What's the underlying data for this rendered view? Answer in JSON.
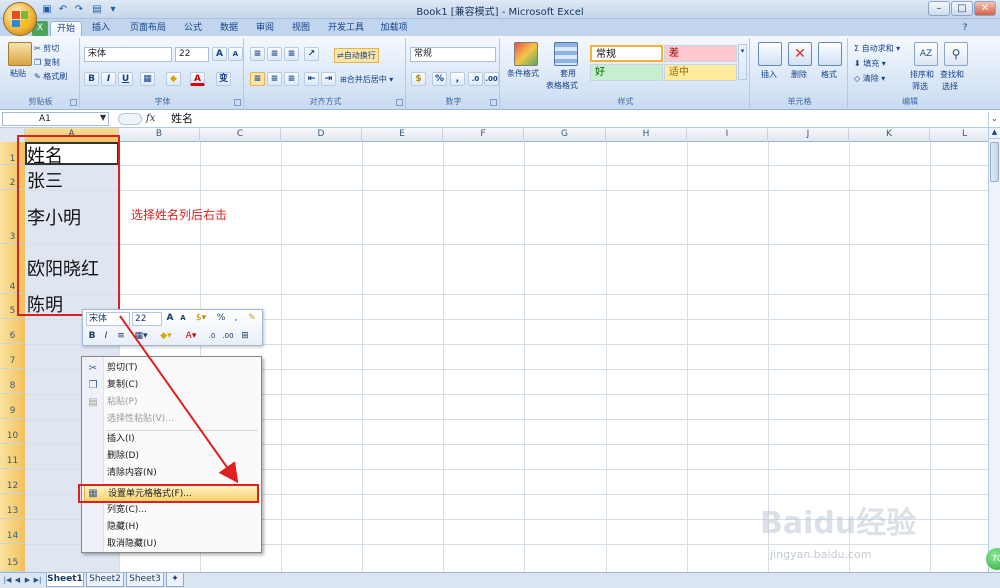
{
  "window": {
    "title": "Book1  [兼容模式] - Microsoft Excel",
    "buttons": [
      "–",
      "□",
      "✕"
    ]
  },
  "ribbon_tabs": [
    "开始",
    "插入",
    "页面布局",
    "公式",
    "数据",
    "审阅",
    "视图",
    "开发工具",
    "加载项"
  ],
  "groups": {
    "clipboard": {
      "label": "剪贴板",
      "paste": "粘贴",
      "cut": "剪切",
      "copy": "复制",
      "format_painter": "格式刷"
    },
    "font": {
      "label": "字体",
      "name": "宋体",
      "size": "22",
      "bold": "B",
      "italic": "I",
      "underline": "U",
      "grow": "A",
      "shrink": "A",
      "phonetic": "变"
    },
    "alignment": {
      "label": "对齐方式",
      "wrap": "自动换行",
      "merge": "合并后居中"
    },
    "number": {
      "label": "数字",
      "format": "常规",
      "percent": "%",
      "comma": ","
    },
    "styles": {
      "label": "样式",
      "cond": "条件格式",
      "table1": "套用",
      "table2": "表格格式",
      "normal": "常规",
      "bad": "差",
      "good": "好",
      "neutral": "适中"
    },
    "cells": {
      "label": "单元格",
      "insert": "插入",
      "delete": "删除",
      "format": "格式"
    },
    "editing": {
      "label": "编辑",
      "autosum": "自动求和",
      "fill": "填充",
      "clear": "清除",
      "sort1": "排序和",
      "sort2": "筛选",
      "find1": "查找和",
      "find2": "选择"
    }
  },
  "formula_bar": {
    "name_box": "A1",
    "fx": "fx",
    "content": "姓名"
  },
  "columns": [
    "A",
    "B",
    "C",
    "D",
    "E",
    "F",
    "G",
    "H",
    "I",
    "J",
    "K",
    "L"
  ],
  "rows": [
    "1",
    "2",
    "3",
    "4",
    "5",
    "6",
    "7",
    "8",
    "9",
    "10",
    "11",
    "12",
    "13",
    "14",
    "15"
  ],
  "cells": [
    "姓名",
    "张三",
    "李小明",
    "欧阳晓红",
    "陈明"
  ],
  "annotation": "选择姓名列后右击",
  "mini_toolbar": {
    "font": "宋体",
    "size": "22",
    "bold": "B",
    "italic": "I",
    "percent": "%",
    "comma": ","
  },
  "context_menu": [
    {
      "label": "剪切(T)",
      "icon": "scissors-icon",
      "disabled": false
    },
    {
      "label": "复制(C)",
      "icon": "copy-icon",
      "disabled": false
    },
    {
      "label": "粘贴(P)",
      "icon": "paste-icon",
      "disabled": true
    },
    {
      "label": "选择性粘贴(V)...",
      "icon": "",
      "disabled": true
    },
    {
      "label": "插入(I)",
      "icon": "",
      "disabled": false
    },
    {
      "label": "删除(D)",
      "icon": "",
      "disabled": false
    },
    {
      "label": "清除内容(N)",
      "icon": "",
      "disabled": false
    },
    {
      "label": "设置单元格格式(F)...",
      "icon": "format-cells-icon",
      "disabled": false,
      "highlighted": true
    },
    {
      "label": "列宽(C)...",
      "icon": "",
      "disabled": false
    },
    {
      "label": "隐藏(H)",
      "icon": "",
      "disabled": false
    },
    {
      "label": "取消隐藏(U)",
      "icon": "",
      "disabled": false
    }
  ],
  "sheets": [
    "Sheet1",
    "Sheet2",
    "Sheet3"
  ],
  "watermark": {
    "logo": "Baidu经验",
    "url": "jingyan.baidu.com"
  },
  "zoom_badge": "70",
  "colors": {
    "accent": "#15428b",
    "annotation_red": "#e02020",
    "selection_orange": "#f2c35e"
  }
}
